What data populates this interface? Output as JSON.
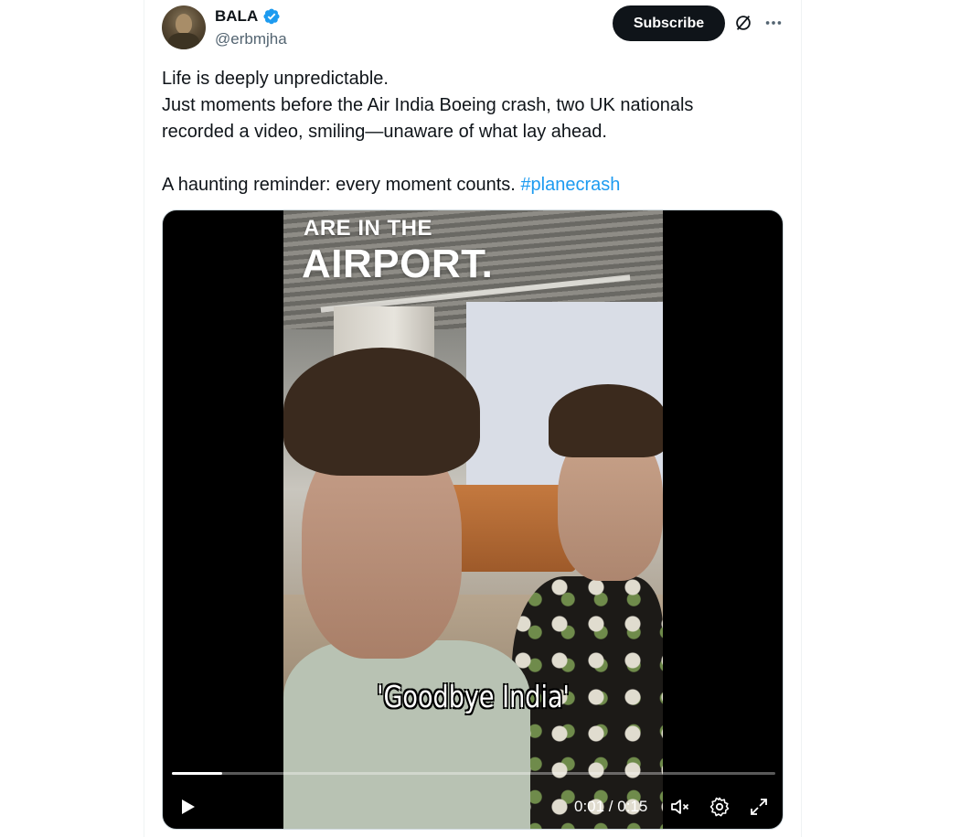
{
  "author": {
    "display_name": "BALA",
    "handle": "@erbmjha",
    "verified": true
  },
  "header": {
    "subscribe_label": "Subscribe",
    "icons": [
      "grok-icon",
      "more-icon"
    ]
  },
  "tweet": {
    "lines": [
      "Life is deeply unpredictable.",
      "Just moments before the Air India Boeing crash, two UK nationals",
      "recorded a video, smiling—unaware of what lay ahead.",
      "A haunting reminder: every moment counts."
    ],
    "hashtag": "#planecrash"
  },
  "video": {
    "overlay_text_top": "ARE IN THE",
    "overlay_text_big": "AIRPORT.",
    "caption": "'Goodbye India'",
    "time": "0:01 / 0:15",
    "progress_fraction": 0.083,
    "controls": [
      "play-icon",
      "mute-icon",
      "settings-icon",
      "fullscreen-icon"
    ]
  },
  "colors": {
    "accent": "#1d9bf0",
    "button_dark": "#0f1419",
    "muted_text": "#536471"
  }
}
